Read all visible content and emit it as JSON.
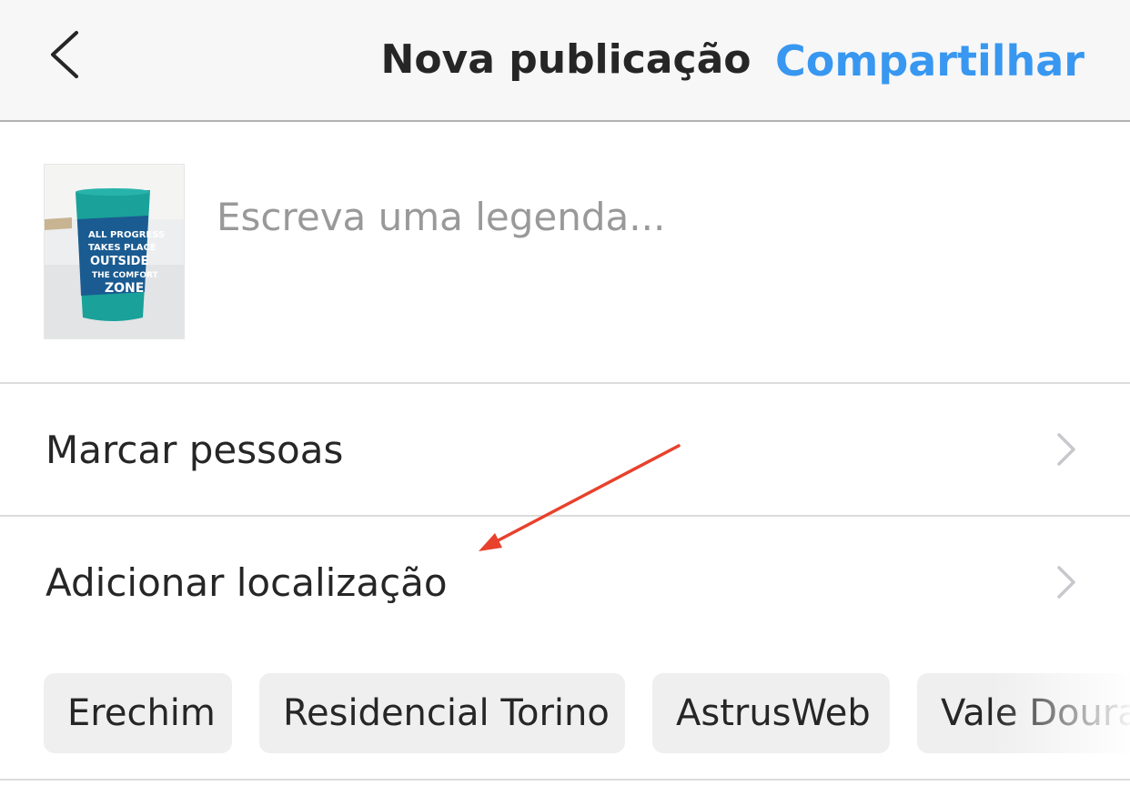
{
  "header": {
    "title": "Nova publicação",
    "share_label": "Compartilhar"
  },
  "composer": {
    "caption_placeholder": "Escreva uma legenda...",
    "caption_value": "",
    "thumbnail_icon": "photo-thumbnail-icon"
  },
  "options": [
    {
      "label": "Marcar pessoas"
    },
    {
      "label": "Adicionar localização"
    }
  ],
  "location_suggestions": [
    "Erechim",
    "Residencial Torino",
    "AstrusWeb",
    "Vale Doura"
  ],
  "colors": {
    "accent": "#3897f0",
    "text": "#262626",
    "placeholder": "#999999",
    "annotation_arrow": "#e8412c"
  }
}
